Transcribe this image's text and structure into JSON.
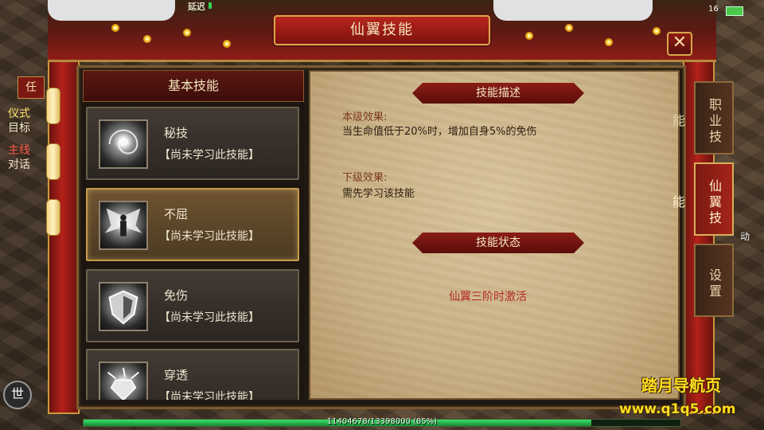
{
  "status": {
    "latency_label": "延迟",
    "top_num": "16"
  },
  "window": {
    "title": "仙翼技能",
    "close_symbol": "✕"
  },
  "left_widgets": {
    "task_badge": "任",
    "tab1_line1": "仪式",
    "tab1_line2": "目标",
    "tab2_line1": "主线",
    "tab2_line2": "对话",
    "mic_label": "世"
  },
  "skill_list": {
    "header": "基本技能",
    "items": [
      {
        "name": "秘技",
        "state": "【尚未学习此技能】",
        "icon": "swirl-icon"
      },
      {
        "name": "不屈",
        "state": "【尚未学习此技能】",
        "icon": "winged-warrior-icon"
      },
      {
        "name": "免伤",
        "state": "【尚未学习此技能】",
        "icon": "shield-icon"
      },
      {
        "name": "穿透",
        "state": "【尚未学习此技能】",
        "icon": "gem-burst-icon"
      }
    ],
    "selected_index": 1
  },
  "detail": {
    "desc_title": "技能描述",
    "current_label": "本级效果:",
    "current_text": "当生命值低于20%时，增加自身5%的免伤",
    "next_label": "下级效果:",
    "next_text": "需先学习该技能",
    "status_title": "技能状态",
    "status_text": "仙翼三阶时激活"
  },
  "side_tabs": [
    {
      "label": "职业技能",
      "active": false
    },
    {
      "label": "仙翼技能",
      "active": true
    },
    {
      "label": "设置",
      "active": false
    }
  ],
  "side_extra_label": "动",
  "exp": {
    "text": "11404678/13398000 (85%)",
    "percent": 85
  },
  "watermark": {
    "line1": "踏月导航页",
    "line2": "www.q1q5.com"
  },
  "colors": {
    "accent_red": "#8a1d16",
    "gold": "#d6a94a",
    "exp_green": "#3ee06a",
    "activate_red": "#b32b1f"
  }
}
